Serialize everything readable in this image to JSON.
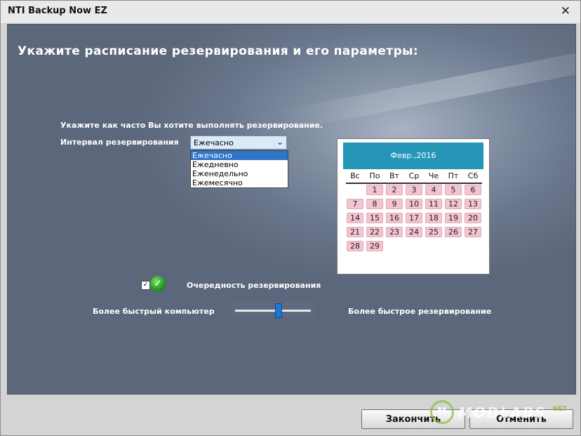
{
  "window": {
    "title": "NTI Backup Now EZ",
    "close_glyph": "✕"
  },
  "heading": "Укажите расписание резервирования и его параметры:",
  "frequency_prompt": "Укажите как часто Вы хотите выполнять резервирование.",
  "interval": {
    "label": "Интервал резервирования",
    "selected": "Ежечасно",
    "options": [
      "Ежечасно",
      "Ежедневно",
      "Еженедельно",
      "Ежемесячно"
    ]
  },
  "calendar": {
    "month_label": "Февр.,2016",
    "weekdays": [
      "Вс",
      "По",
      "Вт",
      "Ср",
      "Че",
      "Пт",
      "Сб"
    ],
    "days": [
      "1",
      "2",
      "3",
      "4",
      "5",
      "6",
      "7",
      "8",
      "9",
      "10",
      "11",
      "12",
      "13",
      "14",
      "15",
      "16",
      "17",
      "18",
      "19",
      "20",
      "21",
      "22",
      "23",
      "24",
      "25",
      "26",
      "27",
      "28",
      "29"
    ],
    "first_weekday_index": 1
  },
  "priority": {
    "checked": true,
    "label": "Очередность резервирования"
  },
  "speed": {
    "left_label": "Более быстрый компьютер",
    "right_label": "Более быстрое резервирование",
    "value": 0.57
  },
  "buttons": {
    "finish": "Закончить",
    "cancel": "Отменить"
  },
  "watermark": {
    "text": "MODLABS",
    "suffix": "NET",
    "badge": "M"
  },
  "colors": {
    "calendar_header": "#2596b8",
    "day_cell": "#f2c5d0",
    "slider_thumb": "#1a78d4",
    "selection": "#3074c8"
  }
}
